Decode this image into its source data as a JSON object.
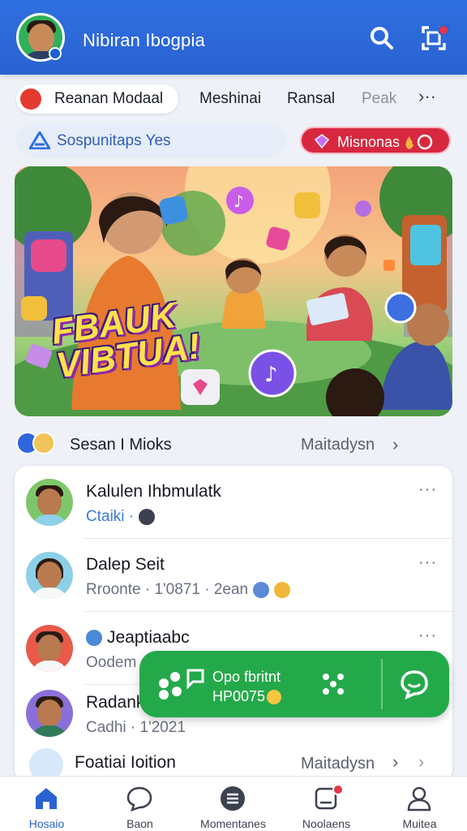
{
  "header": {
    "title": "Nibiran Ibogpia",
    "search_icon": "search-icon",
    "scan_icon": "scan-icon"
  },
  "categories": [
    {
      "label": "Reanan Modaal",
      "active": true
    },
    {
      "label": "Meshinai",
      "active": false
    },
    {
      "label": "Ransal",
      "active": false
    },
    {
      "label": "Peak",
      "active": false
    }
  ],
  "categories_more": "›··",
  "chips": {
    "suggestion": "Sospunitaps Yes",
    "premium": "Misnonas"
  },
  "banner": {
    "headline": "FBAUK VIBTUA!"
  },
  "section": {
    "title": "Sesan I Mioks",
    "link": "Maitadysn",
    "chevron": "›"
  },
  "list": [
    {
      "name": "Kalulen Ihbmulatk",
      "meta": "Ctaiki ·",
      "more": "···"
    },
    {
      "name": "Dalep Seit",
      "meta": "Rroonte · 1'0871 · 2ean",
      "more": "···"
    },
    {
      "name": "Jeaptiaabc",
      "meta": "Oodem",
      "more": "···"
    },
    {
      "name": "Radank",
      "meta": "Cadhi · 1'2021",
      "more": ""
    }
  ],
  "list_footer": {
    "label": "Foatiai Ioition",
    "link": "Maitadysn",
    "chevron": "›",
    "chevron2": "›"
  },
  "action_bar": {
    "line1": "Opo fbritnt",
    "line2": "HP0075"
  },
  "nav": [
    {
      "label": "Hosaio",
      "icon": "home-icon",
      "active": true
    },
    {
      "label": "Baon",
      "icon": "chat-bubble-icon",
      "active": false
    },
    {
      "label": "Momentanes",
      "icon": "menu-list-icon",
      "active": false
    },
    {
      "label": "Noolaens",
      "icon": "notification-icon",
      "active": false
    },
    {
      "label": "Muitea",
      "icon": "profile-icon",
      "active": false
    }
  ],
  "colors": {
    "brand_blue": "#2a62d2",
    "accent_red": "#d8283f",
    "action_green": "#24a94a"
  }
}
